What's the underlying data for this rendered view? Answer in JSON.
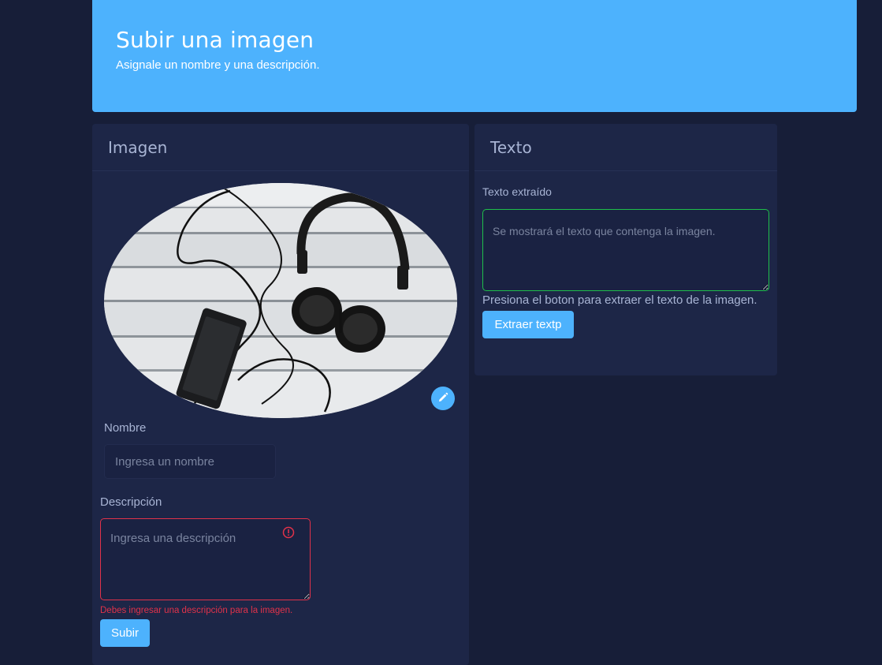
{
  "header": {
    "title": "Subir una imagen",
    "subtitle": "Asignale un nombre y una descripción."
  },
  "image_card": {
    "title": "Imagen",
    "edit_icon": "pencil-icon",
    "name_label": "Nombre",
    "name_placeholder": "Ingresa un nombre",
    "name_value": "",
    "description_label": "Descripción",
    "description_placeholder": "Ingresa una descripción",
    "description_value": "",
    "error_icon": "exclamation-circle-icon",
    "description_error": "Debes ingresar una descripción para la imagen.",
    "submit_label": "Subir"
  },
  "text_card": {
    "title": "Texto",
    "extracted_label": "Texto extraído",
    "extracted_placeholder": "Se mostrará el texto que contenga la imagen.",
    "extracted_value": "",
    "help_text": "Presiona el boton para extraer el texto de la imagen.",
    "extract_label": "Extraer textp"
  },
  "colors": {
    "background": "#171e38",
    "card": "#1d2647",
    "accent": "#4db2fd",
    "error": "#e0324a",
    "success": "#1fbf4b"
  }
}
